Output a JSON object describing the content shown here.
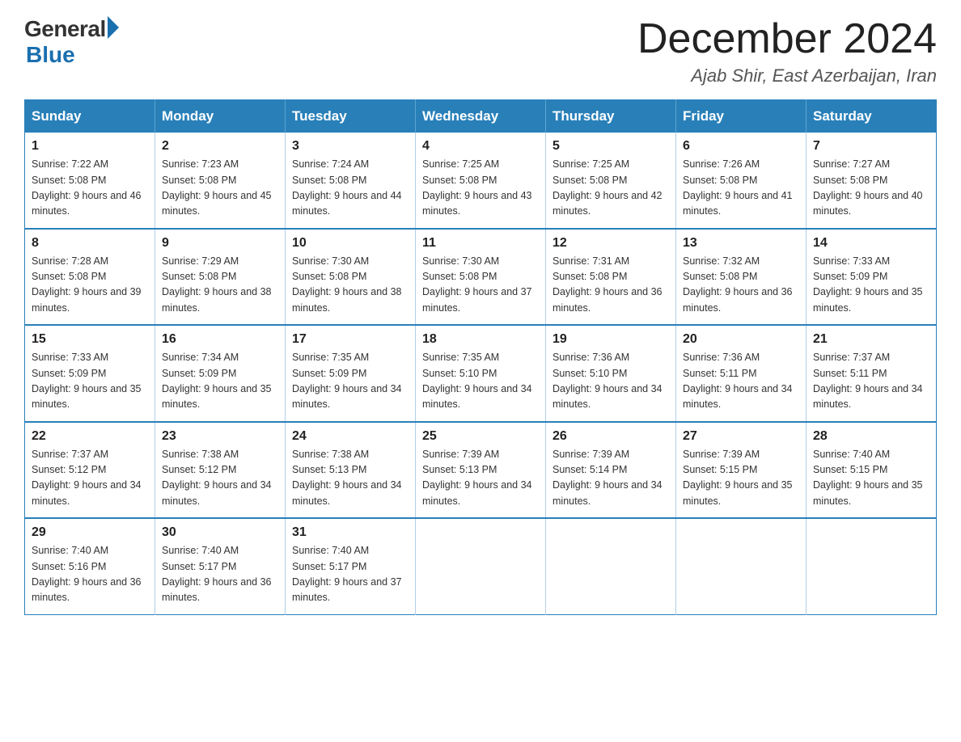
{
  "logo": {
    "general": "General",
    "blue": "Blue"
  },
  "header": {
    "month_year": "December 2024",
    "location": "Ajab Shir, East Azerbaijan, Iran"
  },
  "days_of_week": [
    "Sunday",
    "Monday",
    "Tuesday",
    "Wednesday",
    "Thursday",
    "Friday",
    "Saturday"
  ],
  "weeks": [
    [
      {
        "day": "1",
        "sunrise": "7:22 AM",
        "sunset": "5:08 PM",
        "daylight": "9 hours and 46 minutes."
      },
      {
        "day": "2",
        "sunrise": "7:23 AM",
        "sunset": "5:08 PM",
        "daylight": "9 hours and 45 minutes."
      },
      {
        "day": "3",
        "sunrise": "7:24 AM",
        "sunset": "5:08 PM",
        "daylight": "9 hours and 44 minutes."
      },
      {
        "day": "4",
        "sunrise": "7:25 AM",
        "sunset": "5:08 PM",
        "daylight": "9 hours and 43 minutes."
      },
      {
        "day": "5",
        "sunrise": "7:25 AM",
        "sunset": "5:08 PM",
        "daylight": "9 hours and 42 minutes."
      },
      {
        "day": "6",
        "sunrise": "7:26 AM",
        "sunset": "5:08 PM",
        "daylight": "9 hours and 41 minutes."
      },
      {
        "day": "7",
        "sunrise": "7:27 AM",
        "sunset": "5:08 PM",
        "daylight": "9 hours and 40 minutes."
      }
    ],
    [
      {
        "day": "8",
        "sunrise": "7:28 AM",
        "sunset": "5:08 PM",
        "daylight": "9 hours and 39 minutes."
      },
      {
        "day": "9",
        "sunrise": "7:29 AM",
        "sunset": "5:08 PM",
        "daylight": "9 hours and 38 minutes."
      },
      {
        "day": "10",
        "sunrise": "7:30 AM",
        "sunset": "5:08 PM",
        "daylight": "9 hours and 38 minutes."
      },
      {
        "day": "11",
        "sunrise": "7:30 AM",
        "sunset": "5:08 PM",
        "daylight": "9 hours and 37 minutes."
      },
      {
        "day": "12",
        "sunrise": "7:31 AM",
        "sunset": "5:08 PM",
        "daylight": "9 hours and 36 minutes."
      },
      {
        "day": "13",
        "sunrise": "7:32 AM",
        "sunset": "5:08 PM",
        "daylight": "9 hours and 36 minutes."
      },
      {
        "day": "14",
        "sunrise": "7:33 AM",
        "sunset": "5:09 PM",
        "daylight": "9 hours and 35 minutes."
      }
    ],
    [
      {
        "day": "15",
        "sunrise": "7:33 AM",
        "sunset": "5:09 PM",
        "daylight": "9 hours and 35 minutes."
      },
      {
        "day": "16",
        "sunrise": "7:34 AM",
        "sunset": "5:09 PM",
        "daylight": "9 hours and 35 minutes."
      },
      {
        "day": "17",
        "sunrise": "7:35 AM",
        "sunset": "5:09 PM",
        "daylight": "9 hours and 34 minutes."
      },
      {
        "day": "18",
        "sunrise": "7:35 AM",
        "sunset": "5:10 PM",
        "daylight": "9 hours and 34 minutes."
      },
      {
        "day": "19",
        "sunrise": "7:36 AM",
        "sunset": "5:10 PM",
        "daylight": "9 hours and 34 minutes."
      },
      {
        "day": "20",
        "sunrise": "7:36 AM",
        "sunset": "5:11 PM",
        "daylight": "9 hours and 34 minutes."
      },
      {
        "day": "21",
        "sunrise": "7:37 AM",
        "sunset": "5:11 PM",
        "daylight": "9 hours and 34 minutes."
      }
    ],
    [
      {
        "day": "22",
        "sunrise": "7:37 AM",
        "sunset": "5:12 PM",
        "daylight": "9 hours and 34 minutes."
      },
      {
        "day": "23",
        "sunrise": "7:38 AM",
        "sunset": "5:12 PM",
        "daylight": "9 hours and 34 minutes."
      },
      {
        "day": "24",
        "sunrise": "7:38 AM",
        "sunset": "5:13 PM",
        "daylight": "9 hours and 34 minutes."
      },
      {
        "day": "25",
        "sunrise": "7:39 AM",
        "sunset": "5:13 PM",
        "daylight": "9 hours and 34 minutes."
      },
      {
        "day": "26",
        "sunrise": "7:39 AM",
        "sunset": "5:14 PM",
        "daylight": "9 hours and 34 minutes."
      },
      {
        "day": "27",
        "sunrise": "7:39 AM",
        "sunset": "5:15 PM",
        "daylight": "9 hours and 35 minutes."
      },
      {
        "day": "28",
        "sunrise": "7:40 AM",
        "sunset": "5:15 PM",
        "daylight": "9 hours and 35 minutes."
      }
    ],
    [
      {
        "day": "29",
        "sunrise": "7:40 AM",
        "sunset": "5:16 PM",
        "daylight": "9 hours and 36 minutes."
      },
      {
        "day": "30",
        "sunrise": "7:40 AM",
        "sunset": "5:17 PM",
        "daylight": "9 hours and 36 minutes."
      },
      {
        "day": "31",
        "sunrise": "7:40 AM",
        "sunset": "5:17 PM",
        "daylight": "9 hours and 37 minutes."
      },
      null,
      null,
      null,
      null
    ]
  ]
}
